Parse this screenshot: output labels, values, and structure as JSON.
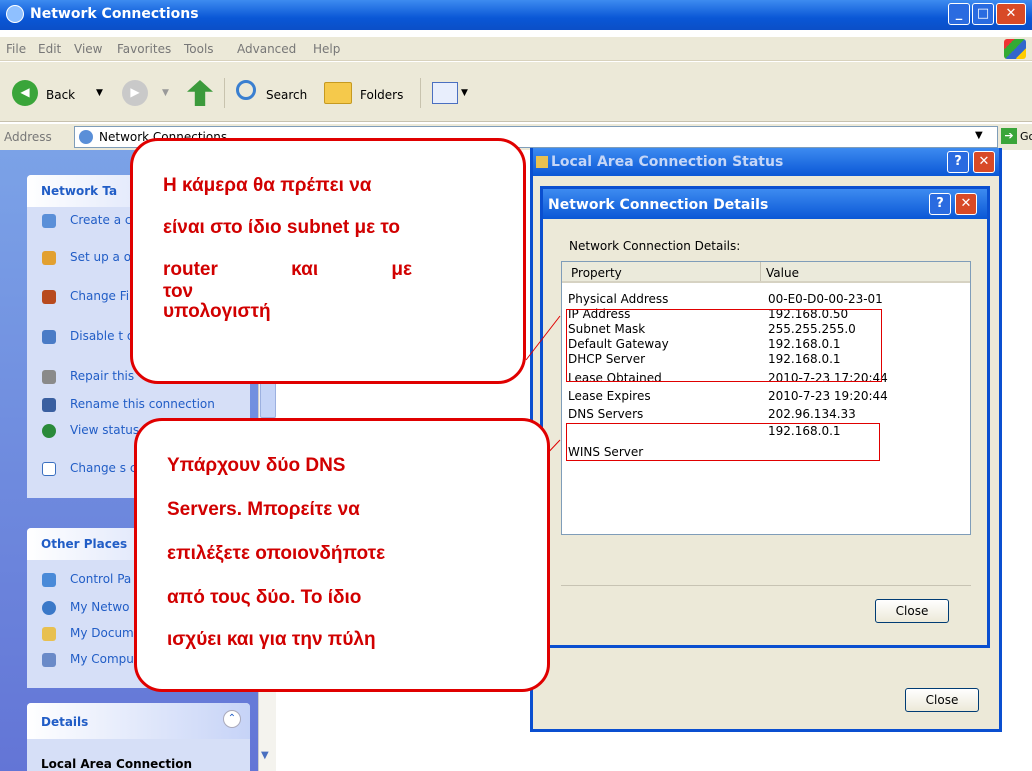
{
  "window": {
    "title": "Network Connections"
  },
  "menu": [
    "File",
    "Edit",
    "View",
    "Favorites",
    "Tools",
    "Advanced",
    "Help"
  ],
  "toolbar": {
    "back": "Back",
    "search": "Search",
    "folders": "Folders"
  },
  "address": {
    "label": "Address",
    "value": "Network Connections",
    "go": "Go"
  },
  "left_pane": {
    "network_tasks": {
      "header": "Network Ta",
      "items": [
        "Create a connecti",
        "Set up a office ne",
        "Change Firewall",
        "Disable t device",
        "Repair this",
        "Rename this connection",
        "View status connection",
        "Change s connection"
      ]
    },
    "other_places": {
      "header": "Other Places",
      "items": [
        "Control Pa",
        "My Netwo",
        "My Docum",
        "My Compu"
      ]
    },
    "details": {
      "header": "Details",
      "item": "Local Area Connection"
    }
  },
  "status_window": {
    "title": "Local Area Connection Status",
    "close_button": "Close"
  },
  "details_window": {
    "title": "Network Connection Details",
    "label": "Network Connection Details:",
    "columns": [
      "Property",
      "Value"
    ],
    "rows": [
      {
        "property": "Physical Address",
        "value": "00-E0-D0-00-23-01"
      },
      {
        "property": "IP Address",
        "value": "192.168.0.50"
      },
      {
        "property": "Subnet Mask",
        "value": "255.255.255.0"
      },
      {
        "property": "Default Gateway",
        "value": "192.168.0.1"
      },
      {
        "property": "DHCP Server",
        "value": "192.168.0.1"
      },
      {
        "property": "Lease Obtained",
        "value": "2010-7-23 17:20:44"
      },
      {
        "property": "Lease Expires",
        "value": "2010-7-23 19:20:44"
      },
      {
        "property": "DNS Servers",
        "value": "202.96.134.33"
      },
      {
        "property": "",
        "value": "192.168.0.1"
      },
      {
        "property": "WINS Server",
        "value": ""
      }
    ],
    "close_button": "Close"
  },
  "callouts": {
    "subnet": [
      "Η κάμερα θα πρέπει να",
      "είναι στο ίδιο subnet με το",
      "router και με τον",
      "υπολογιστή"
    ],
    "dns": [
      "Υπάρχουν δύο DNS",
      "Servers. Μπορείτε να",
      "επιλέξετε οποιονδήποτε",
      "από τους δύο. Το ίδιο",
      "ισχύει και για την πύλη"
    ]
  },
  "colors": {
    "titlebar": "#0a57d6",
    "callout": "#d10000",
    "task_link": "#215dc6"
  }
}
